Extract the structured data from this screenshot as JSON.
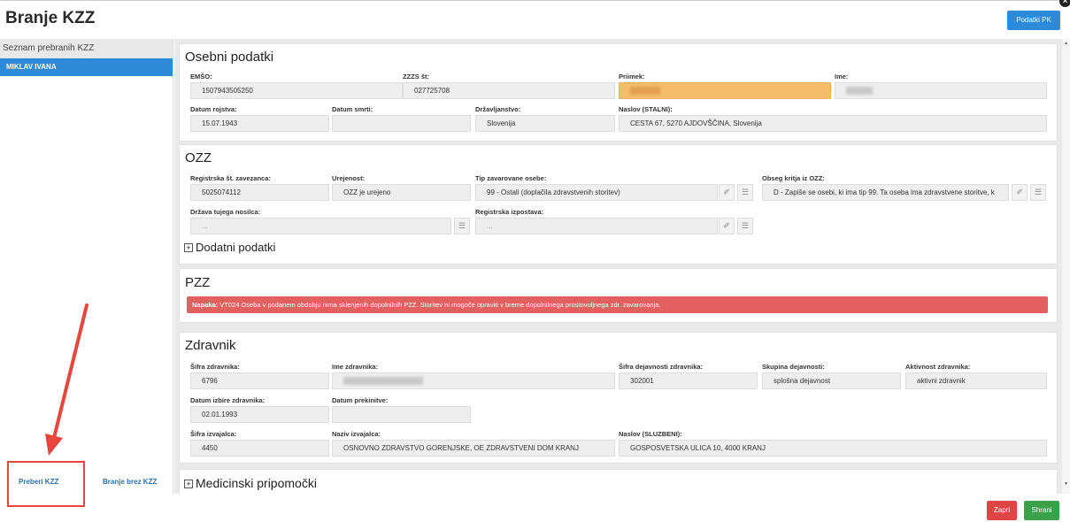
{
  "window": {
    "title": "Branje KZZ",
    "close_glyph": "×"
  },
  "header": {
    "pk_button": "Podatki PK"
  },
  "sidebar": {
    "heading": "Seznam prebranih KZZ",
    "items": [
      {
        "label": "MIKLAV IVANA"
      }
    ],
    "footer": {
      "read_kzz": "Preberi KZZ",
      "read_without_kzz": "Branje brez KZZ"
    }
  },
  "osebni": {
    "title": "Osebni podatki",
    "emso": {
      "label": "EMŠO:",
      "value": "1507943505250"
    },
    "zzzs": {
      "label": "ZZZS št:",
      "value": "027725708"
    },
    "priimek": {
      "label": "Priimek:"
    },
    "ime": {
      "label": "Ime:"
    },
    "rojstvo": {
      "label": "Datum rojstva:",
      "value": "15.07.1943"
    },
    "smrt": {
      "label": "Datum smrti:",
      "value": ""
    },
    "drzavljanstvo": {
      "label": "Državljanstvo:",
      "value": "Slovenija"
    },
    "naslov": {
      "label": "Naslov (STALNI):",
      "value": "CESTA 67, 5270 AJDOVŠČINA, Slovenija"
    }
  },
  "ozz": {
    "title": "OZZ",
    "reg_st": {
      "label": "Registrska št. zavezanca:",
      "value": "5025074112"
    },
    "urejenost": {
      "label": "Urejenost:",
      "value": "OZZ je urejeno"
    },
    "tip": {
      "label": "Tip zavarovane osebe:",
      "value": "99 - Ostali (doplačila zdravstvenih storitev)"
    },
    "obseg": {
      "label": "Obseg kritja iz OZZ:",
      "value": "D - Zapiše se osebi, ki ima tip 99. Ta oseba ima zdravstvene storitve, k"
    },
    "drzava": {
      "label": "Država tujega nosilca:",
      "placeholder": "..."
    },
    "izpostava": {
      "label": "Registrska izpostava:",
      "placeholder": "..."
    },
    "dodatni": "Dodatni podatki"
  },
  "pzz": {
    "title": "PZZ",
    "error_label": "Napaka:",
    "error_text": " VT024 Oseba v podanem obdobju nima sklenjenih dopolnilnih PZZ. Storitev ni mogoče opraviti v breme dopolnilnega prostovoljnega zdr. zavarovanja."
  },
  "zdravnik": {
    "title": "Zdravnik",
    "sifra": {
      "label": "Šifra zdravnika:",
      "value": "6796"
    },
    "ime": {
      "label": "Ime zdravnika:"
    },
    "sifra_dej": {
      "label": "Šifra dejavnosti zdravnika:",
      "value": "302001"
    },
    "skupina": {
      "label": "Skupina dejavnosti:",
      "value": "splošna dejavnost"
    },
    "aktivnost": {
      "label": "Aktivnost zdravnika:",
      "value": "aktivni zdravnik"
    },
    "izbira": {
      "label": "Datum izbire zdravnika:",
      "value": "02.01.1993"
    },
    "prekinitev": {
      "label": "Datum prekinitve:",
      "value": ""
    },
    "izvajalec_sifra": {
      "label": "Šifra izvajalca:",
      "value": "4450"
    },
    "izvajalec_naziv": {
      "label": "Naziv izvajalca:",
      "value": "OSNOVNO ZDRAVSTVO GORENJSKE, OE ZDRAVSTVENI DOM KRANJ"
    },
    "naslov": {
      "label": "Naslov (SLUZBENI):",
      "value": "GOSPOSVETSKA ULICA 10, 4000 KRANJ"
    }
  },
  "medicinski": {
    "title": "Medicinski pripomočki"
  },
  "footer": {
    "close": "Zapri",
    "save": "Shrani"
  },
  "icons": {
    "eraser": "eraser-icon",
    "list": "list-icon",
    "arrow": "annotation-arrow",
    "glyph_eraser": "✐",
    "glyph_list": "☰",
    "glyph_plus": "+",
    "glyph_up": "▲",
    "glyph_down": "▼"
  },
  "colors": {
    "accent": "#2d8ad8",
    "warning_field": "#f5bd6a",
    "error": "#e36060",
    "close": "#e04545",
    "save": "#3aa04a",
    "annotation": "#e8453c"
  }
}
